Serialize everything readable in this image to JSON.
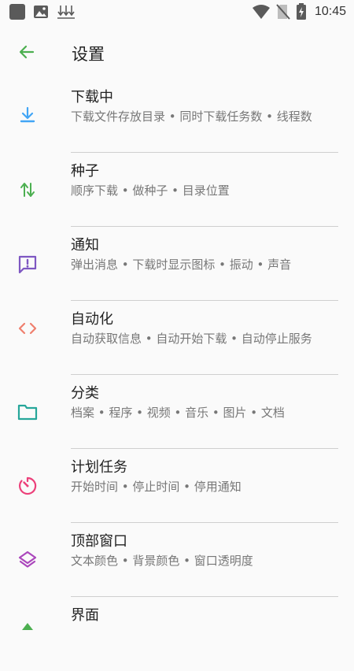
{
  "status_bar": {
    "time": "10:45"
  },
  "toolbar": {
    "title": "设置",
    "back_icon": "arrow-left-icon"
  },
  "colors": {
    "back": "#4caf50",
    "download": "#42a5f5",
    "torrent": "#4caf50",
    "notification": "#7e57c2",
    "automation": "#ef7f6d",
    "category": "#26a69a",
    "schedule": "#ec407a",
    "top_window": "#ab47bc",
    "interface": "#4caf50"
  },
  "settings": [
    {
      "title": "下载中",
      "subtitle": "下载文件存放目录 • 同时下载任务数 • 线程数",
      "icon": "download-icon"
    },
    {
      "title": "种子",
      "subtitle": "顺序下载 • 做种子 • 目录位置",
      "icon": "swap-vertical-icon"
    },
    {
      "title": "通知",
      "subtitle": "弹出消息 • 下载时显示图标 • 振动 • 声音",
      "icon": "alert-message-icon"
    },
    {
      "title": "自动化",
      "subtitle": "自动获取信息 • 自动开始下载 • 自动停止服务",
      "icon": "code-brackets-icon"
    },
    {
      "title": "分类",
      "subtitle": "档案 • 程序 • 视频 • 音乐 • 图片 • 文档",
      "icon": "folder-icon"
    },
    {
      "title": "计划任务",
      "subtitle": "开始时间 • 停止时间 • 停用通知",
      "icon": "timer-icon"
    },
    {
      "title": "顶部窗口",
      "subtitle": "文本颜色 • 背景颜色 • 窗口透明度",
      "icon": "layers-icon"
    },
    {
      "title": "界面",
      "subtitle": "",
      "icon": "theme-icon"
    }
  ]
}
